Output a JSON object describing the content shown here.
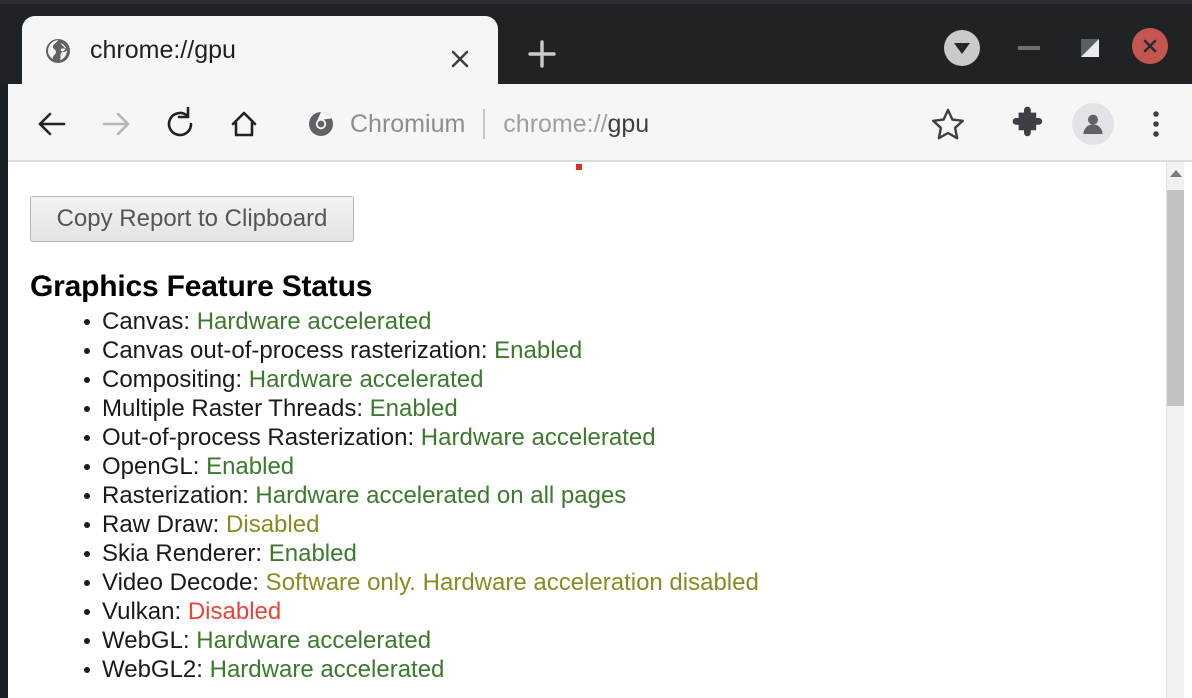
{
  "window": {
    "controls": {
      "download_badge": "download-badge",
      "minimize_label": "Minimize",
      "maximize_label": "Restore",
      "close_label": "Close"
    }
  },
  "tabstrip": {
    "tabs": [
      {
        "title": "chrome://gpu",
        "favicon": "globe-icon",
        "close_label": "Close tab"
      }
    ],
    "new_tab_label": "New tab"
  },
  "toolbar": {
    "back_label": "Back",
    "forward_label": "Forward",
    "reload_label": "Reload",
    "home_label": "Home",
    "brand": "Chromium",
    "url_scheme": "chrome://",
    "url_host": "gpu",
    "bookmark_label": "Bookmark this tab",
    "extensions_label": "Extensions",
    "profile_label": "Profile",
    "menu_label": "Customize and control Chromium"
  },
  "page": {
    "copy_button": "Copy Report to Clipboard",
    "title": "Graphics Feature Status",
    "colors": {
      "enabled": "#3a7a2c",
      "warning": "#8a8a22",
      "error": "#e8443a",
      "label": "#1a1a1a"
    },
    "features": [
      {
        "label": "Canvas:",
        "value": "Hardware accelerated",
        "state": "enabled"
      },
      {
        "label": "Canvas out-of-process rasterization:",
        "value": "Enabled",
        "state": "enabled"
      },
      {
        "label": "Compositing:",
        "value": "Hardware accelerated",
        "state": "enabled"
      },
      {
        "label": "Multiple Raster Threads:",
        "value": "Enabled",
        "state": "enabled"
      },
      {
        "label": "Out-of-process Rasterization:",
        "value": "Hardware accelerated",
        "state": "enabled"
      },
      {
        "label": "OpenGL:",
        "value": "Enabled",
        "state": "enabled"
      },
      {
        "label": "Rasterization:",
        "value": "Hardware accelerated on all pages",
        "state": "enabled"
      },
      {
        "label": "Raw Draw:",
        "value": "Disabled",
        "state": "warning"
      },
      {
        "label": "Skia Renderer:",
        "value": "Enabled",
        "state": "enabled"
      },
      {
        "label": "Video Decode:",
        "value": "Software only. Hardware acceleration disabled",
        "state": "warning"
      },
      {
        "label": "Vulkan:",
        "value": "Disabled",
        "state": "error"
      },
      {
        "label": "WebGL:",
        "value": "Hardware accelerated",
        "state": "enabled"
      },
      {
        "label": "WebGL2:",
        "value": "Hardware accelerated",
        "state": "enabled"
      }
    ]
  },
  "scrollbar": {
    "up_arrow": "scroll-up-arrow"
  }
}
